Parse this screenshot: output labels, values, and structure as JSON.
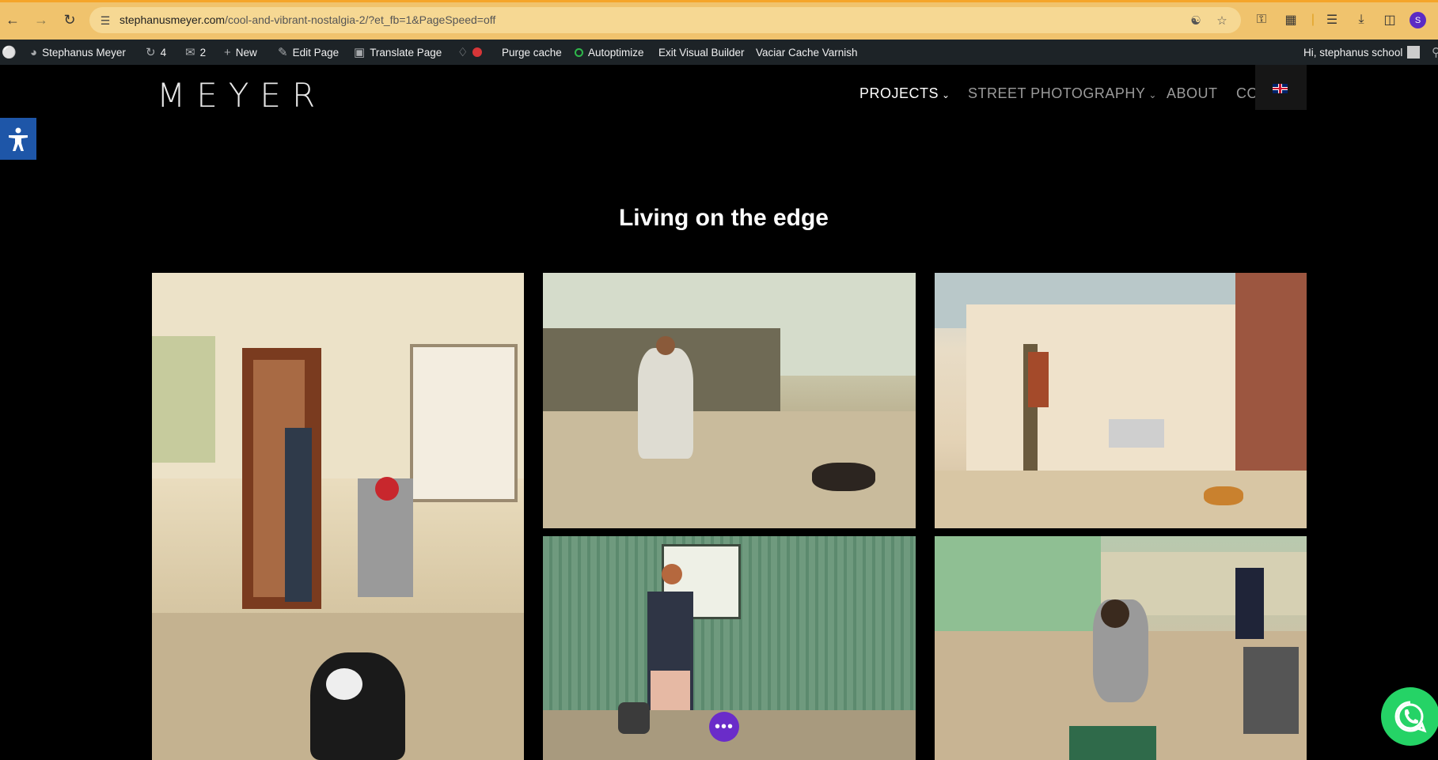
{
  "browser": {
    "url_domain": "stephanusmeyer.com",
    "url_path": "/cool-and-vibrant-nostalgia-2/?et_fb=1&PageSpeed=off",
    "profile_initial": "S"
  },
  "adminbar": {
    "site_name": "Stephanus Meyer",
    "updates_count": "4",
    "comments_count": "2",
    "new_label": "New",
    "edit_page_label": "Edit Page",
    "translate_page_label": "Translate Page",
    "purge_cache_label": "Purge cache",
    "autoptimize_label": "Autoptimize",
    "exit_builder_label": "Exit Visual Builder",
    "vaciar_cache_label": "Vaciar Cache Varnish",
    "greeting": "Hi, stephanus school"
  },
  "header": {
    "logo": "MEYER",
    "menu": [
      {
        "label": "PROJECTS",
        "has_dropdown": true,
        "color": "#ffffff"
      },
      {
        "label": "STREET PHOTOGRAPHY",
        "has_dropdown": true,
        "color": "#9a9a9a"
      },
      {
        "label": "ABOUT",
        "has_dropdown": false,
        "color": "#9a9a9a"
      },
      {
        "label": "CO",
        "has_dropdown": false,
        "color": "#9a9a9a"
      }
    ]
  },
  "page": {
    "section_title": "Living on the edge"
  },
  "gallery": {
    "images": [
      {
        "name": "photo-woman-doorway-dog"
      },
      {
        "name": "photo-woman-seated-fence-dog"
      },
      {
        "name": "photo-man-beside-house"
      },
      {
        "name": "photo-woman-green-shack"
      },
      {
        "name": "photo-man-crouching-yard"
      }
    ]
  },
  "icons": {
    "accessibility": "accessibility-icon",
    "chat": "chat-dots-icon",
    "whatsapp": "whatsapp-icon"
  }
}
